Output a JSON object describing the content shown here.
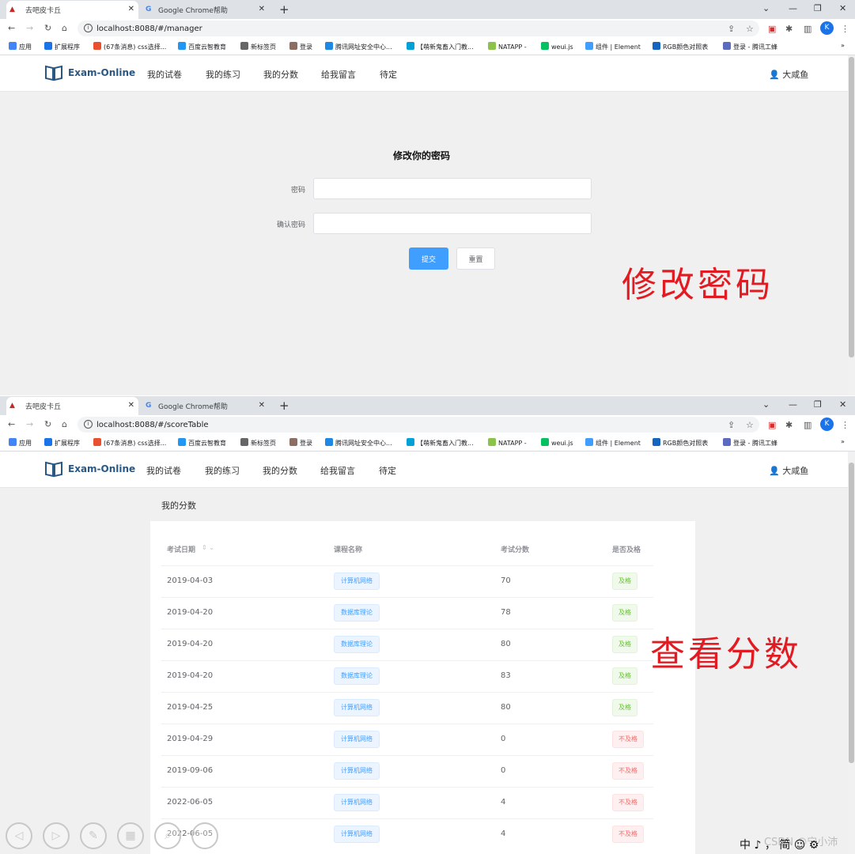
{
  "browser": {
    "tabs": [
      {
        "title": "去吧皮卡丘"
      },
      {
        "title": "Google Chrome帮助"
      }
    ],
    "bookmarks": [
      {
        "label": "应用",
        "color": "#4285f4"
      },
      {
        "label": "扩展程序",
        "color": "#1a73e8"
      },
      {
        "label": "(67条消息) css选择...",
        "color": "#e8502f"
      },
      {
        "label": "百度云智教育",
        "color": "#2196f3"
      },
      {
        "label": "新标签页",
        "color": "#666666"
      },
      {
        "label": "登录",
        "color": "#8d6e63"
      },
      {
        "label": "腾讯网址安全中心...",
        "color": "#1e88e5"
      },
      {
        "label": "【萌新鬼畜入门教...",
        "color": "#00a1d6"
      },
      {
        "label": "NATAPP -",
        "color": "#8bc34a"
      },
      {
        "label": "weui.js",
        "color": "#07c160"
      },
      {
        "label": "组件 | Element",
        "color": "#409eff"
      },
      {
        "label": "RGB颜色对照表",
        "color": "#1565c0"
      },
      {
        "label": "登录 - 腾讯工蜂",
        "color": "#5c6bc0"
      }
    ],
    "more": "»",
    "avatar_letter": "K"
  },
  "app": {
    "brand": "Exam-Online",
    "nav": [
      "我的试卷",
      "我的练习",
      "我的分数",
      "给我留言",
      "待定"
    ],
    "user": "大咸鱼"
  },
  "top": {
    "url": "localhost:8088/#/manager",
    "form": {
      "title": "修改你的密码",
      "password_label": "密码",
      "confirm_label": "确认密码",
      "submit": "提交",
      "reset": "重置"
    },
    "annotation": "修改密码"
  },
  "bottom": {
    "url": "localhost:8088/#/scoreTable",
    "section_title": "我的分数",
    "columns": [
      "考试日期",
      "课程名称",
      "考试分数",
      "是否及格"
    ],
    "rows": [
      {
        "date": "2019-04-03",
        "course": "计算机网络",
        "score": "70",
        "pass": "及格",
        "ok": true
      },
      {
        "date": "2019-04-20",
        "course": "数据库理论",
        "score": "78",
        "pass": "及格",
        "ok": true
      },
      {
        "date": "2019-04-20",
        "course": "数据库理论",
        "score": "80",
        "pass": "及格",
        "ok": true
      },
      {
        "date": "2019-04-20",
        "course": "数据库理论",
        "score": "83",
        "pass": "及格",
        "ok": true
      },
      {
        "date": "2019-04-25",
        "course": "计算机网络",
        "score": "80",
        "pass": "及格",
        "ok": true
      },
      {
        "date": "2019-04-29",
        "course": "计算机网络",
        "score": "0",
        "pass": "不及格",
        "ok": false
      },
      {
        "date": "2019-09-06",
        "course": "计算机网络",
        "score": "0",
        "pass": "不及格",
        "ok": false
      },
      {
        "date": "2022-06-05",
        "course": "计算机网络",
        "score": "4",
        "pass": "不及格",
        "ok": false
      },
      {
        "date": "2022-06-05",
        "course": "计算机网络",
        "score": "4",
        "pass": "不及格",
        "ok": false
      }
    ],
    "annotation": "查看分数"
  },
  "overlay": {
    "ime": "中 ♪ ， 简 ☺ ⚙",
    "watermark": "CSDN @宁小沛"
  }
}
